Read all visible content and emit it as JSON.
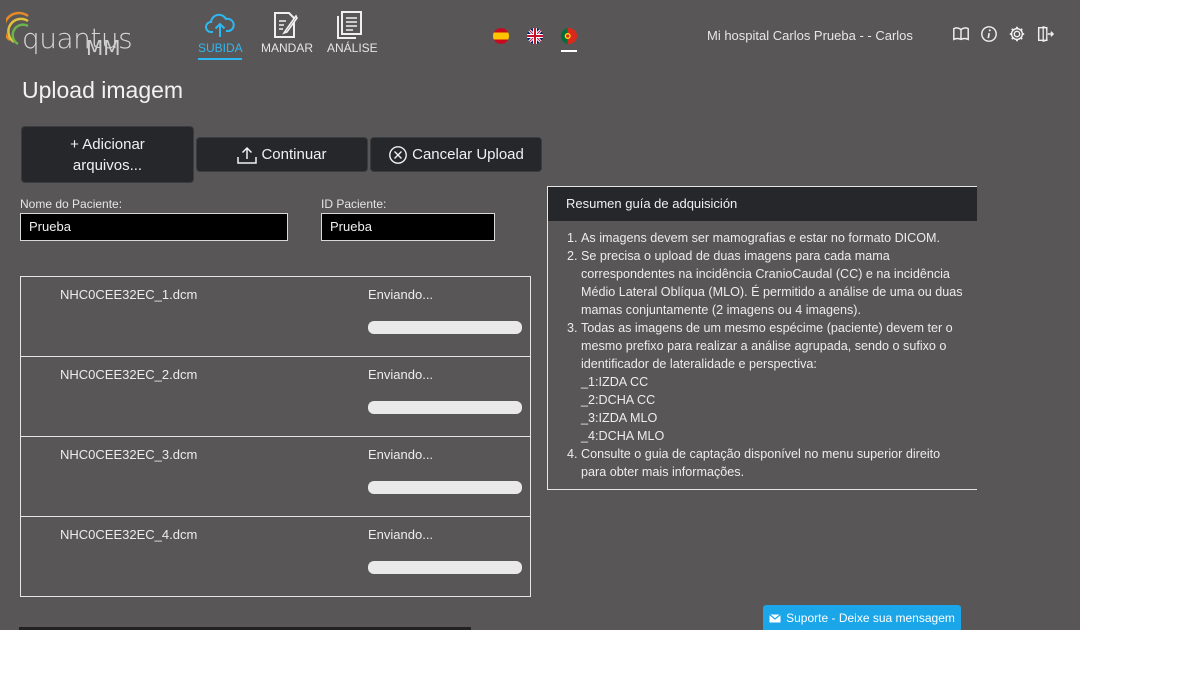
{
  "header": {
    "logo": {
      "brand": "quantus",
      "sub": "MM"
    },
    "nav": [
      {
        "label": "SUBIDA",
        "icon": "cloud-upload-icon",
        "active": true
      },
      {
        "label": "MANDAR",
        "icon": "document-edit-icon",
        "active": false
      },
      {
        "label": "ANÁLISE",
        "icon": "document-list-icon",
        "active": false
      }
    ],
    "languages": [
      "es",
      "gb",
      "pt"
    ],
    "selected_language": "pt",
    "user_text": "Mi hospital Carlos Prueba - - Carlos",
    "tools": [
      "book-icon",
      "info-icon",
      "gear-icon",
      "logout-icon"
    ]
  },
  "page": {
    "title": "Upload imagem",
    "buttons": {
      "add_line1": "+ Adicionar",
      "add_line2": "arquivos...",
      "continue": "Continuar",
      "cancel": "Cancelar Upload"
    },
    "patient_name_label": "Nome do Paciente:",
    "patient_name_value": "Prueba",
    "patient_id_label": "ID Paciente:",
    "patient_id_value": "Prueba"
  },
  "files": [
    {
      "name": "NHC0CEE32EC_1.dcm",
      "status": "Enviando...",
      "progress": 0
    },
    {
      "name": "NHC0CEE32EC_2.dcm",
      "status": "Enviando...",
      "progress": 0
    },
    {
      "name": "NHC0CEE32EC_3.dcm",
      "status": "Enviando...",
      "progress": 0
    },
    {
      "name": "NHC0CEE32EC_4.dcm",
      "status": "Enviando...",
      "progress": 0
    }
  ],
  "guide": {
    "title": "Resumen guía de adquisición",
    "items": [
      "As imagens devem ser mamografias e estar no formato DICOM.",
      "Se precisa o upload de duas imagens para cada mama correspondentes na incidência CranioCaudal (CC) e na incidência Médio Lateral Oblíqua (MLO). É permitido a análise de uma ou duas mamas conjuntamente (2 imagens ou 4 imagens).",
      "Todas as imagens de um mesmo espécime (paciente) devem ter o mesmo prefixo para realizar a análise agrupada, sendo o sufixo o identificador de lateralidade e perspectiva:",
      "Consulte o guia de captação disponível no menu superior direito para obter mais informações."
    ],
    "suffixes": [
      "_1:IZDA CC",
      "_2:DCHA CC",
      "_3:IZDA MLO",
      "_4:DCHA MLO"
    ]
  },
  "support": {
    "label": "Suporte - Deixe sua mensagem"
  },
  "colors": {
    "accent": "#2eb8f2",
    "background": "#585656",
    "panel": "#25272b",
    "support": "#1aa6e8"
  }
}
